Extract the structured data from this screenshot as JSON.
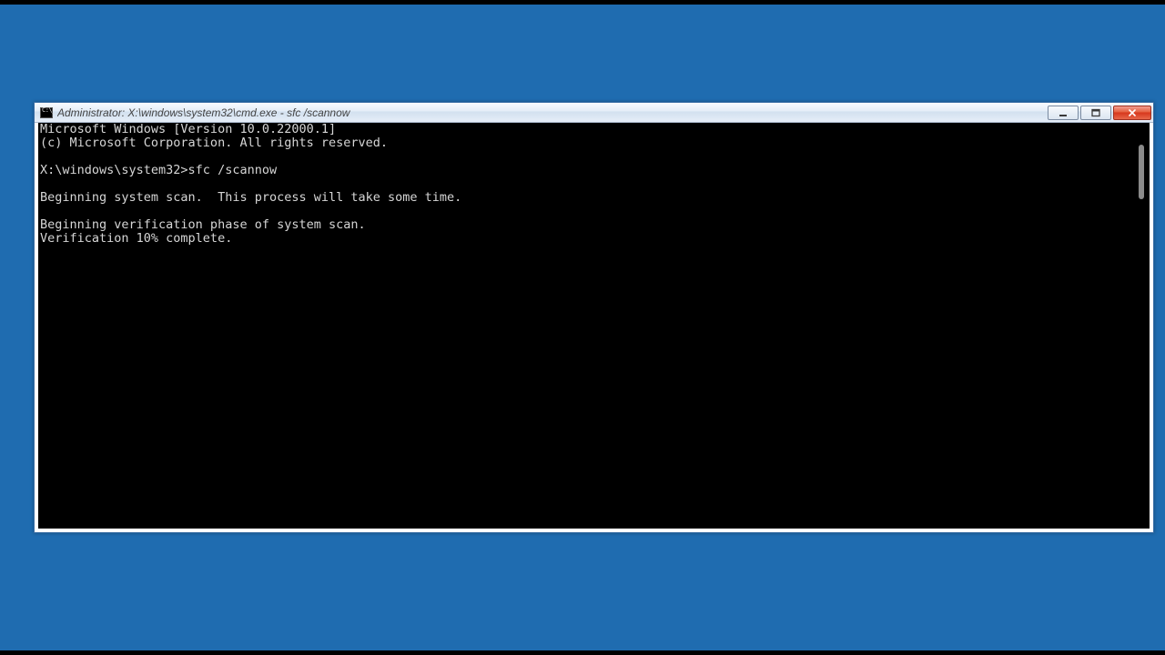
{
  "window": {
    "title": "Administrator: X:\\windows\\system32\\cmd.exe - sfc  /scannow"
  },
  "terminal": {
    "line1": "Microsoft Windows [Version 10.0.22000.1]",
    "line2": "(c) Microsoft Corporation. All rights reserved.",
    "blank1": "",
    "prompt_line": "X:\\windows\\system32>sfc /scannow",
    "blank2": "",
    "line3": "Beginning system scan.  This process will take some time.",
    "blank3": "",
    "line4": "Beginning verification phase of system scan.",
    "line5": "Verification 10% complete."
  }
}
